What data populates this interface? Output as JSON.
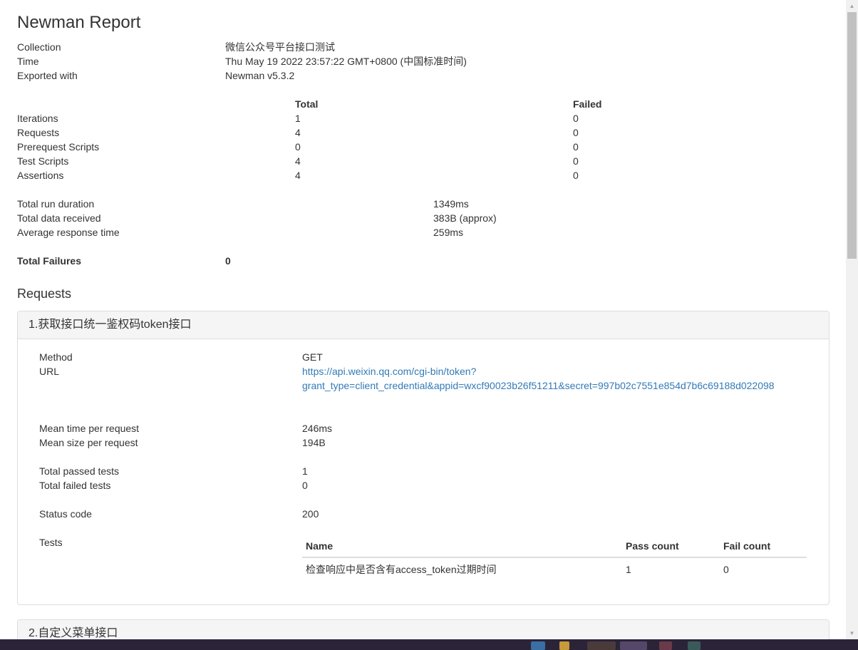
{
  "report": {
    "title": "Newman Report",
    "meta": [
      {
        "label": "Collection",
        "value": "微信公众号平台接口测试"
      },
      {
        "label": "Time",
        "value": "Thu May 19 2022 23:57:22 GMT+0800 (中国标准时间)"
      },
      {
        "label": "Exported with",
        "value": "Newman v5.3.2"
      }
    ]
  },
  "summary": {
    "headers": {
      "total": "Total",
      "failed": "Failed"
    },
    "rows": [
      {
        "label": "Iterations",
        "total": "1",
        "failed": "0"
      },
      {
        "label": "Requests",
        "total": "4",
        "failed": "0"
      },
      {
        "label": "Prerequest Scripts",
        "total": "0",
        "failed": "0"
      },
      {
        "label": "Test Scripts",
        "total": "4",
        "failed": "0"
      },
      {
        "label": "Assertions",
        "total": "4",
        "failed": "0"
      }
    ]
  },
  "durations": [
    {
      "label": "Total run duration",
      "value": "1349ms"
    },
    {
      "label": "Total data received",
      "value": "383B (approx)"
    },
    {
      "label": "Average response time",
      "value": "259ms"
    }
  ],
  "failures": {
    "label": "Total Failures",
    "value": "0"
  },
  "requests": {
    "heading": "Requests",
    "items": [
      {
        "title": "1.获取接口统一鉴权码token接口",
        "method_label": "Method",
        "method": "GET",
        "url_label": "URL",
        "url_line1": "https://api.weixin.qq.com/cgi-bin/token?",
        "url_line2": "grant_type=client_credential&appid=wxcf90023b26f51211&secret=997b02c7551e854d7b6c69188d022098",
        "mean_time_label": "Mean time per request",
        "mean_time": "246ms",
        "mean_size_label": "Mean size per request",
        "mean_size": "194B",
        "passed_label": "Total passed tests",
        "passed": "1",
        "failed_label": "Total failed tests",
        "failed": "0",
        "status_label": "Status code",
        "status": "200",
        "tests_label": "Tests",
        "tests_headers": {
          "name": "Name",
          "pass": "Pass count",
          "fail": "Fail count"
        },
        "tests": [
          {
            "name": "检查响应中是否含有access_token过期时间",
            "pass": "1",
            "fail": "0"
          }
        ]
      },
      {
        "title": "2.自定义菜单接口"
      }
    ]
  },
  "colors": {
    "link": "#337ab7",
    "panel_heading_bg": "#f5f5f5",
    "border": "#dddddd",
    "text": "#333333"
  }
}
